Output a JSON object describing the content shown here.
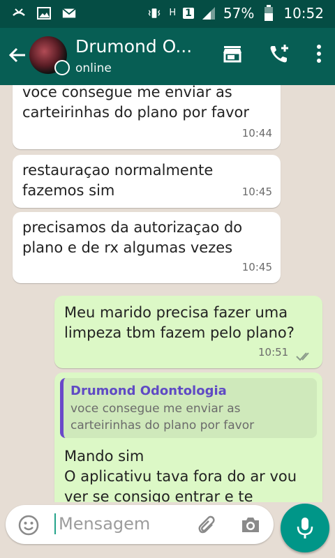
{
  "status_bar": {
    "battery_text": "57%",
    "time": "10:52",
    "network_label": "H",
    "sim_slot": "1"
  },
  "header": {
    "contact_name": "Drumond O...",
    "status": "online"
  },
  "messages": [
    {
      "direction": "in",
      "text_lines": [
        "voce consegue me enviar as",
        "carteirinhas do plano por favor"
      ],
      "time": "10:44"
    },
    {
      "direction": "in",
      "text_lines": [
        "restauraçao normalmente",
        "fazemos sim"
      ],
      "time": "10:45"
    },
    {
      "direction": "in",
      "text_lines": [
        "precisamos da autorizaçao do",
        "plano e de rx algumas vezes"
      ],
      "time": "10:45"
    },
    {
      "direction": "out",
      "text_lines": [
        "Meu marido precisa fazer uma",
        "limpeza tbm fazem pelo plano?"
      ],
      "time": "10:51"
    },
    {
      "direction": "out",
      "quote": {
        "author": "Drumond Odontologia",
        "lines": [
          "voce consegue me enviar as",
          "carteirinhas do plano por favor"
        ]
      },
      "text_lines": [
        "Mando sim",
        "O aplicativu tava fora do ar vou",
        "ver se consigo entrar e te"
      ]
    }
  ],
  "composer": {
    "placeholder": "Mensagem"
  },
  "colors": {
    "header": "#075e54",
    "status_bar": "#054d44",
    "outgoing": "#dcf8c6",
    "incoming": "#ffffff",
    "accent": "#009688"
  }
}
